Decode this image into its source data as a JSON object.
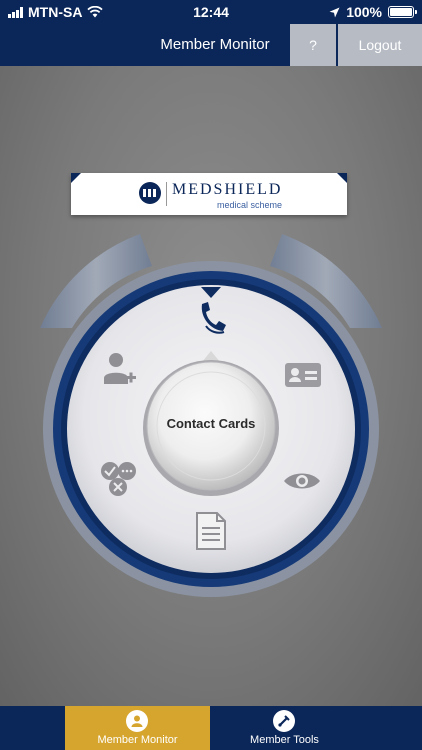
{
  "status_bar": {
    "carrier": "MTN-SA",
    "time": "12:44",
    "battery": "100%",
    "battery_level": 1.0
  },
  "nav": {
    "title": "Member Monitor",
    "help_label": "?",
    "logout_label": "Logout"
  },
  "logo": {
    "name": "MEDSHIELD",
    "tagline": "medical scheme"
  },
  "dial": {
    "center_label": "Contact Cards",
    "items": [
      {
        "icon": "phone-icon",
        "selected": true
      },
      {
        "icon": "id-card-icon",
        "selected": false
      },
      {
        "icon": "eye-icon",
        "selected": false
      },
      {
        "icon": "document-icon",
        "selected": false
      },
      {
        "icon": "approvals-icon",
        "selected": false
      },
      {
        "icon": "add-user-icon",
        "selected": false
      }
    ]
  },
  "tabs": [
    {
      "label": "Member Monitor",
      "icon": "member-icon",
      "active": true
    },
    {
      "label": "Member Tools",
      "icon": "tools-icon",
      "active": false
    }
  ],
  "colors": {
    "navy": "#0b2658",
    "tab_active": "#d6a52e",
    "button_grey": "#b6bbc4"
  }
}
